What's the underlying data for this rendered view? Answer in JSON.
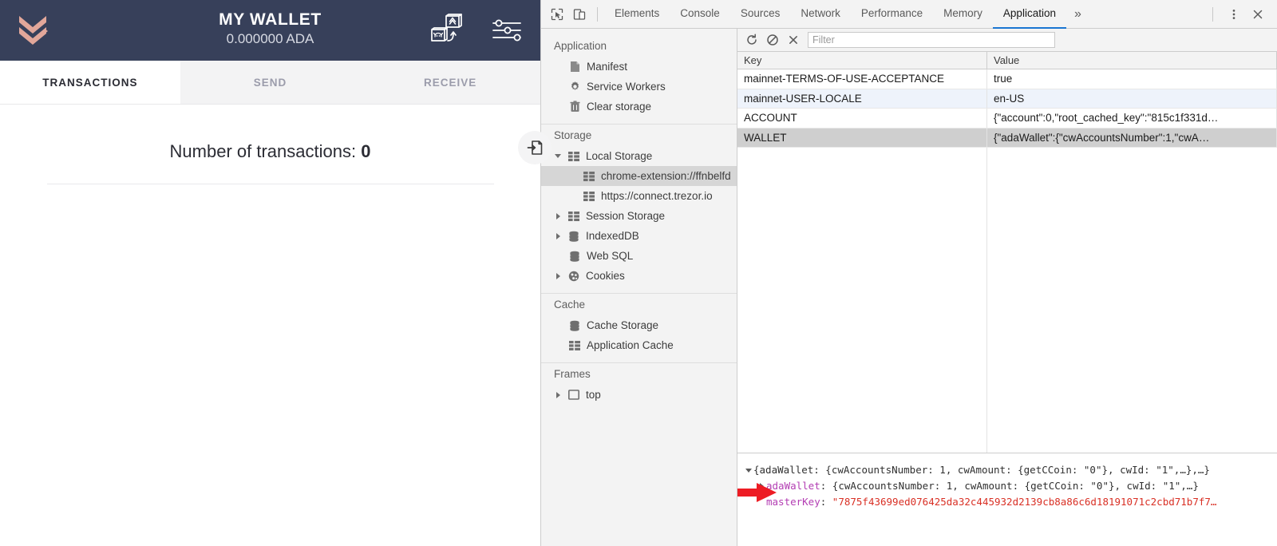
{
  "wallet": {
    "logo_icon": "yoroi-chevron-logo",
    "title": "MY WALLET",
    "amount": "0.000000 ADA",
    "accent_color": "#e2a79a",
    "header_bg": "#37405a",
    "actions": [
      {
        "name": "wallet-switch-icon",
        "label": "Switch wallet"
      },
      {
        "name": "settings-sliders-icon",
        "label": "Settings"
      }
    ],
    "tabs": [
      {
        "label": "TRANSACTIONS",
        "active": true
      },
      {
        "label": "SEND",
        "active": false
      },
      {
        "label": "RECEIVE",
        "active": false
      }
    ],
    "transactions": {
      "count_label": "Number of transactions:",
      "count_value": "0",
      "export_icon": "export-file-icon"
    }
  },
  "devtools": {
    "toolbar": {
      "inspect_icon": "inspect-element-icon",
      "device_icon": "device-toolbar-icon",
      "more_tabs_label": "»",
      "kebab_icon": "more-options-icon",
      "close_icon": "close-icon"
    },
    "tabs": [
      {
        "label": "Elements",
        "active": false
      },
      {
        "label": "Console",
        "active": false
      },
      {
        "label": "Sources",
        "active": false
      },
      {
        "label": "Network",
        "active": false
      },
      {
        "label": "Performance",
        "active": false
      },
      {
        "label": "Memory",
        "active": false
      },
      {
        "label": "Application",
        "active": true
      }
    ],
    "sidebar": {
      "groups": [
        {
          "title": "Application",
          "items": [
            {
              "label": "Manifest",
              "icon": "manifest-file-icon",
              "indent": 2,
              "arrow": "none",
              "selected": false
            },
            {
              "label": "Service Workers",
              "icon": "gear-icon",
              "indent": 2,
              "arrow": "none",
              "selected": false
            },
            {
              "label": "Clear storage",
              "icon": "trash-icon",
              "indent": 2,
              "arrow": "none",
              "selected": false
            }
          ]
        },
        {
          "title": "Storage",
          "items": [
            {
              "label": "Local Storage",
              "icon": "table-grid-icon",
              "indent": 1,
              "arrow": "open",
              "selected": false
            },
            {
              "label": "chrome-extension://ffnbelfd",
              "icon": "table-grid-icon",
              "indent": 3,
              "arrow": "none",
              "selected": true
            },
            {
              "label": "https://connect.trezor.io",
              "icon": "table-grid-icon",
              "indent": 3,
              "arrow": "none",
              "selected": false
            },
            {
              "label": "Session Storage",
              "icon": "table-grid-icon",
              "indent": 1,
              "arrow": "closed",
              "selected": false
            },
            {
              "label": "IndexedDB",
              "icon": "database-icon",
              "indent": 1,
              "arrow": "closed",
              "selected": false
            },
            {
              "label": "Web SQL",
              "icon": "database-icon",
              "indent": 2,
              "arrow": "none",
              "selected": false
            },
            {
              "label": "Cookies",
              "icon": "cookie-icon",
              "indent": 1,
              "arrow": "closed",
              "selected": false
            }
          ]
        },
        {
          "title": "Cache",
          "items": [
            {
              "label": "Cache Storage",
              "icon": "database-icon",
              "indent": 2,
              "arrow": "none",
              "selected": false
            },
            {
              "label": "Application Cache",
              "icon": "table-grid-icon",
              "indent": 2,
              "arrow": "none",
              "selected": false
            }
          ]
        },
        {
          "title": "Frames",
          "items": [
            {
              "label": "top",
              "icon": "frame-icon",
              "indent": 1,
              "arrow": "closed",
              "selected": false
            }
          ]
        }
      ]
    },
    "filterbar": {
      "refresh_icon": "refresh-icon",
      "clear_all_icon": "clear-all-icon",
      "delete_icon": "delete-selected-icon",
      "filter_placeholder": "Filter",
      "filter_value": ""
    },
    "storage_table": {
      "columns": [
        "Key",
        "Value"
      ],
      "rows": [
        {
          "key": "mainnet-TERMS-OF-USE-ACCEPTANCE",
          "value": "true",
          "state": "normal"
        },
        {
          "key": "mainnet-USER-LOCALE",
          "value": "en-US",
          "state": "alt"
        },
        {
          "key": "ACCOUNT",
          "value": "{\"account\":0,\"root_cached_key\":\"815c1f331d…",
          "state": "normal"
        },
        {
          "key": "WALLET",
          "value": "{\"adaWallet\":{\"cwAccountsNumber\":1,\"cwA…",
          "state": "selected"
        }
      ]
    },
    "preview": {
      "line1": "{adaWallet: {cwAccountsNumber: 1, cwAmount: {getCCoin: \"0\"}, cwId: \"1\",…},…}",
      "line2_key": "adaWallet",
      "line2_value": "{cwAccountsNumber: 1, cwAmount: {getCCoin: \"0\"}, cwId: \"1\",…}",
      "line3_key": "masterKey",
      "line3_value": "\"7875f43699ed076425da32c445932d2139cb8a86c6d18191071c2cbd71b7f7…",
      "annotation_icon": "red-arrow-annotation",
      "annotation_color": "#ed1c24"
    }
  }
}
